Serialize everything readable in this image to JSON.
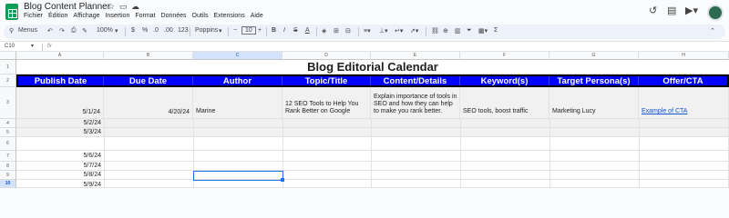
{
  "app": {
    "doc_title": "Blog Content Planner",
    "menus": [
      "Fichier",
      "Édition",
      "Affichage",
      "Insertion",
      "Format",
      "Données",
      "Outils",
      "Extensions",
      "Aide"
    ]
  },
  "toolbar": {
    "menus_label": "Menus",
    "zoom": "100%",
    "currency": "$",
    "percent": "%",
    "dec_less": ".0",
    "dec_more": ".00",
    "number_format": "123",
    "font": "Poppins",
    "font_size": "10",
    "minus": "−",
    "plus": "+"
  },
  "formula_bar": {
    "cell_ref": "C10",
    "fx": "fx",
    "value": ""
  },
  "columns": [
    "A",
    "B",
    "C",
    "D",
    "E",
    "F",
    "G",
    "H"
  ],
  "rows": [
    "1",
    "2",
    "3",
    "4",
    "5",
    "6",
    "7",
    "8",
    "9",
    "10",
    "11"
  ],
  "sheet": {
    "title": "Blog Editorial Calendar",
    "headers": [
      "Publish Date",
      "Due Date",
      "Author",
      "Topic/Title",
      "Content/Details",
      "Keyword(s)",
      "Target Persona(s)",
      "Offer/CTA"
    ],
    "row3": {
      "publish": "5/1/24",
      "due": "4/20/24",
      "author": "Marine",
      "topic": "12 SEO Tools to Help You Rank Better on Google",
      "details": "Explain importance of tools in SEO and how they can help to make you rank better.",
      "keywords": "SEO tools, boost traffic",
      "persona": "Marketing Lucy",
      "cta": "Example of CTA"
    },
    "publish_dates": [
      "5/2/24",
      "5/3/24",
      "",
      "5/6/24",
      "5/7/24",
      "5/8/24",
      "5/9/24"
    ]
  },
  "colors": {
    "header_blue": "#0000ff",
    "select_blue": "#1a73e8",
    "link": "#1155cc"
  }
}
